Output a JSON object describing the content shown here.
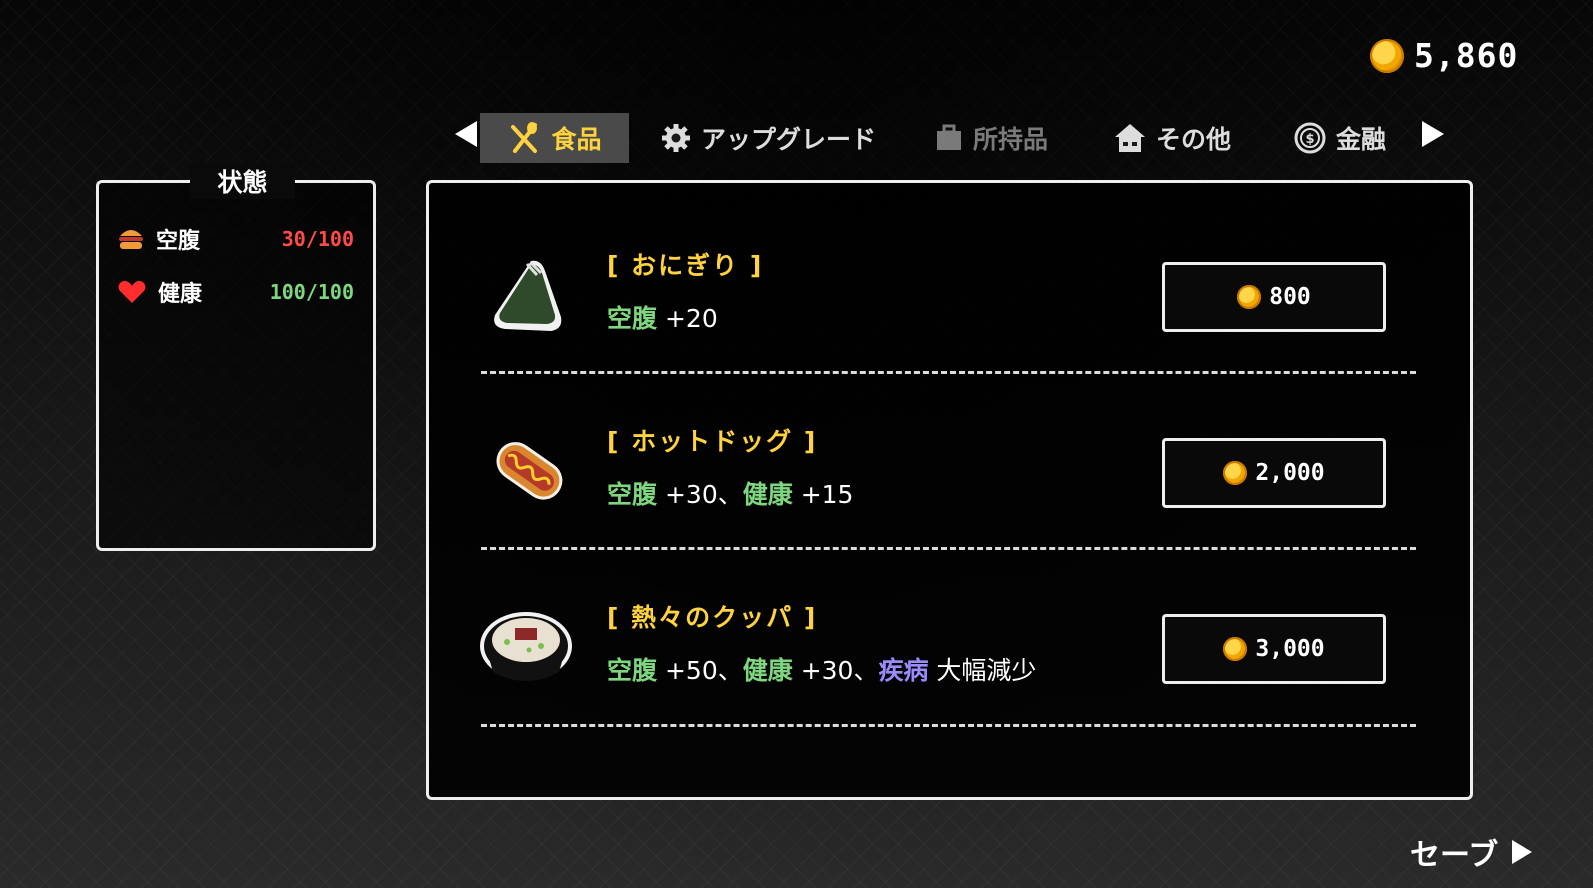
{
  "coins": {
    "icon": "coin-icon",
    "value": "5,860"
  },
  "tabs": [
    {
      "label": "食品",
      "icon": "fork-spoon-icon",
      "state": "active"
    },
    {
      "label": "アップグレード",
      "icon": "gear-icon",
      "state": "normal"
    },
    {
      "label": "所持品",
      "icon": "briefcase-icon",
      "state": "disabled"
    },
    {
      "label": "その他",
      "icon": "house-icon",
      "state": "normal"
    },
    {
      "label": "金融",
      "icon": "dollar-coin-icon",
      "state": "normal"
    }
  ],
  "status": {
    "title": "状態",
    "hunger": {
      "label": "空腹",
      "value": "30/100",
      "icon": "burger-icon",
      "color": "#ff4a4a"
    },
    "health": {
      "label": "健康",
      "value": "100/100",
      "icon": "heart-icon",
      "color": "#7ed67e"
    }
  },
  "items": [
    {
      "name": "[ おにぎり ]",
      "image": "onigiri-icon",
      "effects": {
        "k1": "空腹",
        "v1": " +20"
      },
      "price": "800"
    },
    {
      "name": "[ ホットドッグ ]",
      "image": "hotdog-icon",
      "effects": {
        "k1": "空腹",
        "v1": " +30、",
        "k2": "健康",
        "v2": " +15"
      },
      "price": "2,000"
    },
    {
      "name": "[ 熱々のクッパ ]",
      "image": "gukbap-bowl-icon",
      "effects": {
        "k1": "空腹",
        "v1": " +50、",
        "k2": "健康",
        "v2": " +30、",
        "k3": "疾病",
        "v3": " 大幅減少"
      },
      "price": "3,000"
    }
  ],
  "save_label": "セーブ",
  "colors": {
    "accent": "#ffd23f",
    "green": "#7ed67e",
    "red": "#ff4a4a",
    "purple": "#9a8cff"
  }
}
